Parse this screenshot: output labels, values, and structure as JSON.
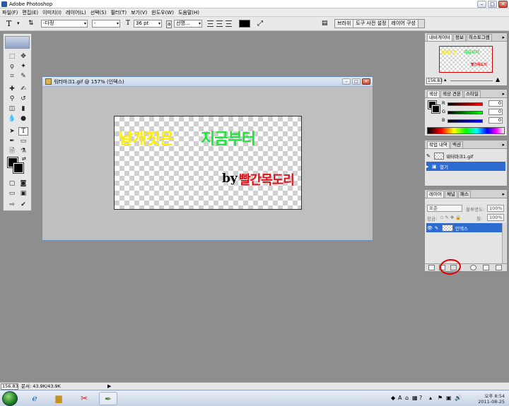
{
  "app": {
    "title": "Adobe Photoshop"
  },
  "menu": [
    "파일(F)",
    "편집(E)",
    "이미지(I)",
    "레이어(L)",
    "선택(S)",
    "필터(T)",
    "보기(V)",
    "윈도우(W)",
    "도움말(H)"
  ],
  "options": {
    "tool_glyph": "T",
    "font_style": "-다정",
    "font_weight": "-",
    "size_glyph": "T",
    "font_size": "36 pt",
    "aa_label": "a",
    "aa_mode": "선명...",
    "warp_glyph": "⤢"
  },
  "palette_well": [
    "브러쉬",
    "도구 사전 설정",
    "레이어 구성"
  ],
  "document": {
    "title": "워터마크1.gif @ 157% (인덱스)",
    "watermark_line1": "날개짓은",
    "watermark_line1b": "지금부터",
    "watermark_by": "by",
    "watermark_author": "빨간목도리",
    "colors": {
      "yellow": "#ffee00",
      "green": "#1ce637",
      "red": "#e8101a"
    }
  },
  "navigator": {
    "tabs": [
      "내비게이터",
      "정보",
      "히스토그램"
    ],
    "zoom": "156.83"
  },
  "color_panel": {
    "tabs": [
      "색상",
      "색상 견본",
      "스타일"
    ],
    "channels": [
      {
        "label": "R",
        "value": "0",
        "color": "#cc0000"
      },
      {
        "label": "G",
        "value": "0",
        "color": "#00aa00"
      },
      {
        "label": "B",
        "value": "0",
        "color": "#0000cc"
      }
    ]
  },
  "history": {
    "tabs": [
      "작업 내역",
      "액션"
    ],
    "snapshot": "워터마크1.gif",
    "step": "열기"
  },
  "layers": {
    "tabs": [
      "레이어",
      "채널",
      "패스"
    ],
    "blend_mode": "표준",
    "opacity_label": "불투명도:",
    "opacity": "100%",
    "lock_label": "잠금:",
    "fill_label": "칠:",
    "fill": "100%",
    "layer_name": "인덱스"
  },
  "status": {
    "zoom": "156.83",
    "doc_size": "문서: 43.9K/43.9K",
    "arrow": "▶"
  },
  "taskbar": {
    "time": "오후 8:54",
    "date": "2011-08-25",
    "ime": "A"
  }
}
